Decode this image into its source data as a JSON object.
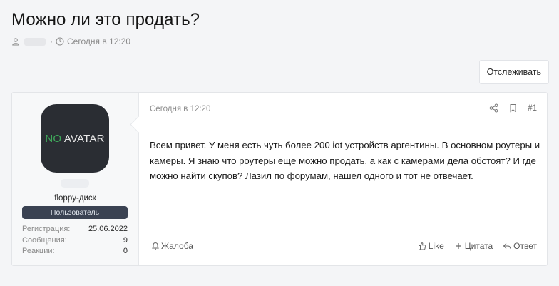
{
  "thread": {
    "title": "Можно ли это продать?",
    "meta_time": "Сегодня в 12:20",
    "watch_label": "Отслеживать"
  },
  "post": {
    "user": {
      "avatar_text_no": "NO",
      "avatar_text_avatar": " AVATAR",
      "username": "floppy-диск",
      "badge": "Пользователь",
      "stats": [
        {
          "label": "Регистрация:",
          "value": "25.06.2022"
        },
        {
          "label": "Сообщения:",
          "value": "9"
        },
        {
          "label": "Реакции:",
          "value": "0"
        }
      ]
    },
    "date": "Сегодня в 12:20",
    "number": "#1",
    "text": "Всем привет. У меня есть чуть более 200 iot устройств аргентины. В основном роутеры и камеры. Я знаю что роутеры еще можно продать, а как с камерами дела обстоят? И где можно найти скупов? Лазил по форумам, нашел одного и тот не отвечает.",
    "report_label": "Жалоба",
    "like_label": "Like",
    "quote_label": "Цитата",
    "reply_label": "Ответ"
  },
  "colors": {
    "avatar_bg": "#2a2d33",
    "avatar_no": "#3ea85a",
    "badge_bg": "#3a4252"
  }
}
